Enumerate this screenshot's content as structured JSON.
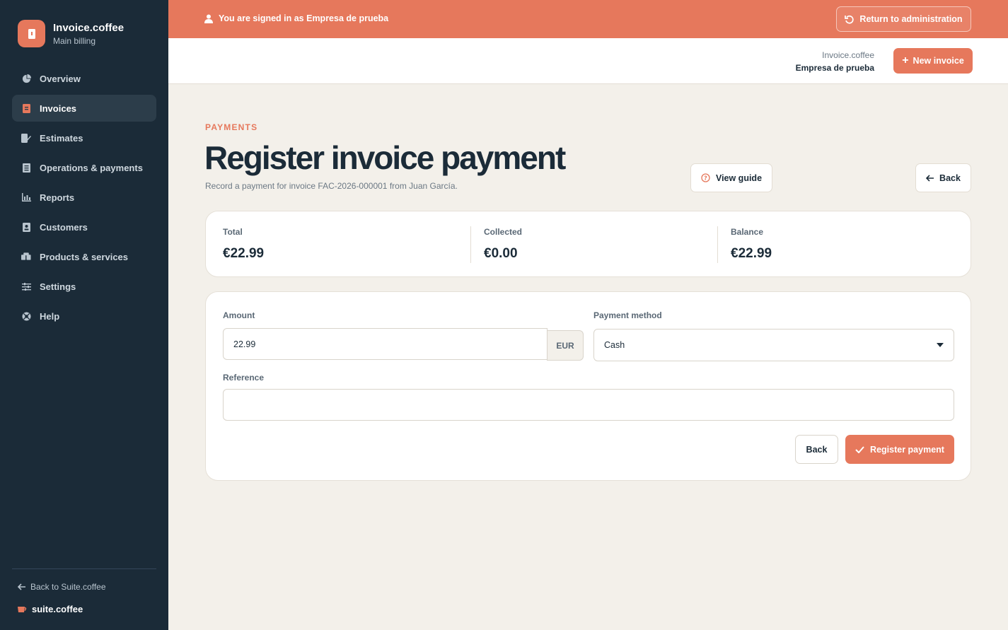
{
  "colors": {
    "accent": "#e6785c",
    "sidebar_bg": "#1b2b38",
    "page_bg": "#f3f0ea"
  },
  "brand": {
    "name": "Invoice.coffee",
    "subtitle": "Main billing",
    "icon": "document-icon"
  },
  "sidebar": {
    "items": [
      {
        "label": "Overview",
        "icon": "pie-chart-icon",
        "active": false
      },
      {
        "label": "Invoices",
        "icon": "invoice-icon",
        "active": true
      },
      {
        "label": "Estimates",
        "icon": "estimate-icon",
        "active": false
      },
      {
        "label": "Operations & payments",
        "icon": "receipt-icon",
        "active": false
      },
      {
        "label": "Reports",
        "icon": "bar-chart-icon",
        "active": false
      },
      {
        "label": "Customers",
        "icon": "contact-card-icon",
        "active": false
      },
      {
        "label": "Products & services",
        "icon": "boxes-icon",
        "active": false
      },
      {
        "label": "Settings",
        "icon": "sliders-icon",
        "active": false
      },
      {
        "label": "Help",
        "icon": "lifebuoy-icon",
        "active": false
      }
    ],
    "back_link": "Back to Suite.coffee",
    "suite_logo": "suite.coffee"
  },
  "banner": {
    "text": "You are signed in as Empresa de prueba",
    "return_label": "Return to administration"
  },
  "topbar": {
    "app_name": "Invoice.coffee",
    "company": "Empresa de prueba",
    "new_invoice_label": "New invoice"
  },
  "page": {
    "eyebrow": "PAYMENTS",
    "title": "Register invoice payment",
    "subtitle": "Record a payment for invoice FAC-2026-000001 from Juan García.",
    "guide_label": "View guide",
    "back_label": "Back"
  },
  "summary": {
    "total_label": "Total",
    "total_value": "€22.99",
    "collected_label": "Collected",
    "collected_value": "€0.00",
    "balance_label": "Balance",
    "balance_value": "€22.99"
  },
  "form": {
    "amount_label": "Amount",
    "amount_value": "22.99",
    "currency": "EUR",
    "method_label": "Payment method",
    "method_value": "Cash",
    "reference_label": "Reference",
    "reference_value": "",
    "back_label": "Back",
    "submit_label": "Register payment"
  }
}
